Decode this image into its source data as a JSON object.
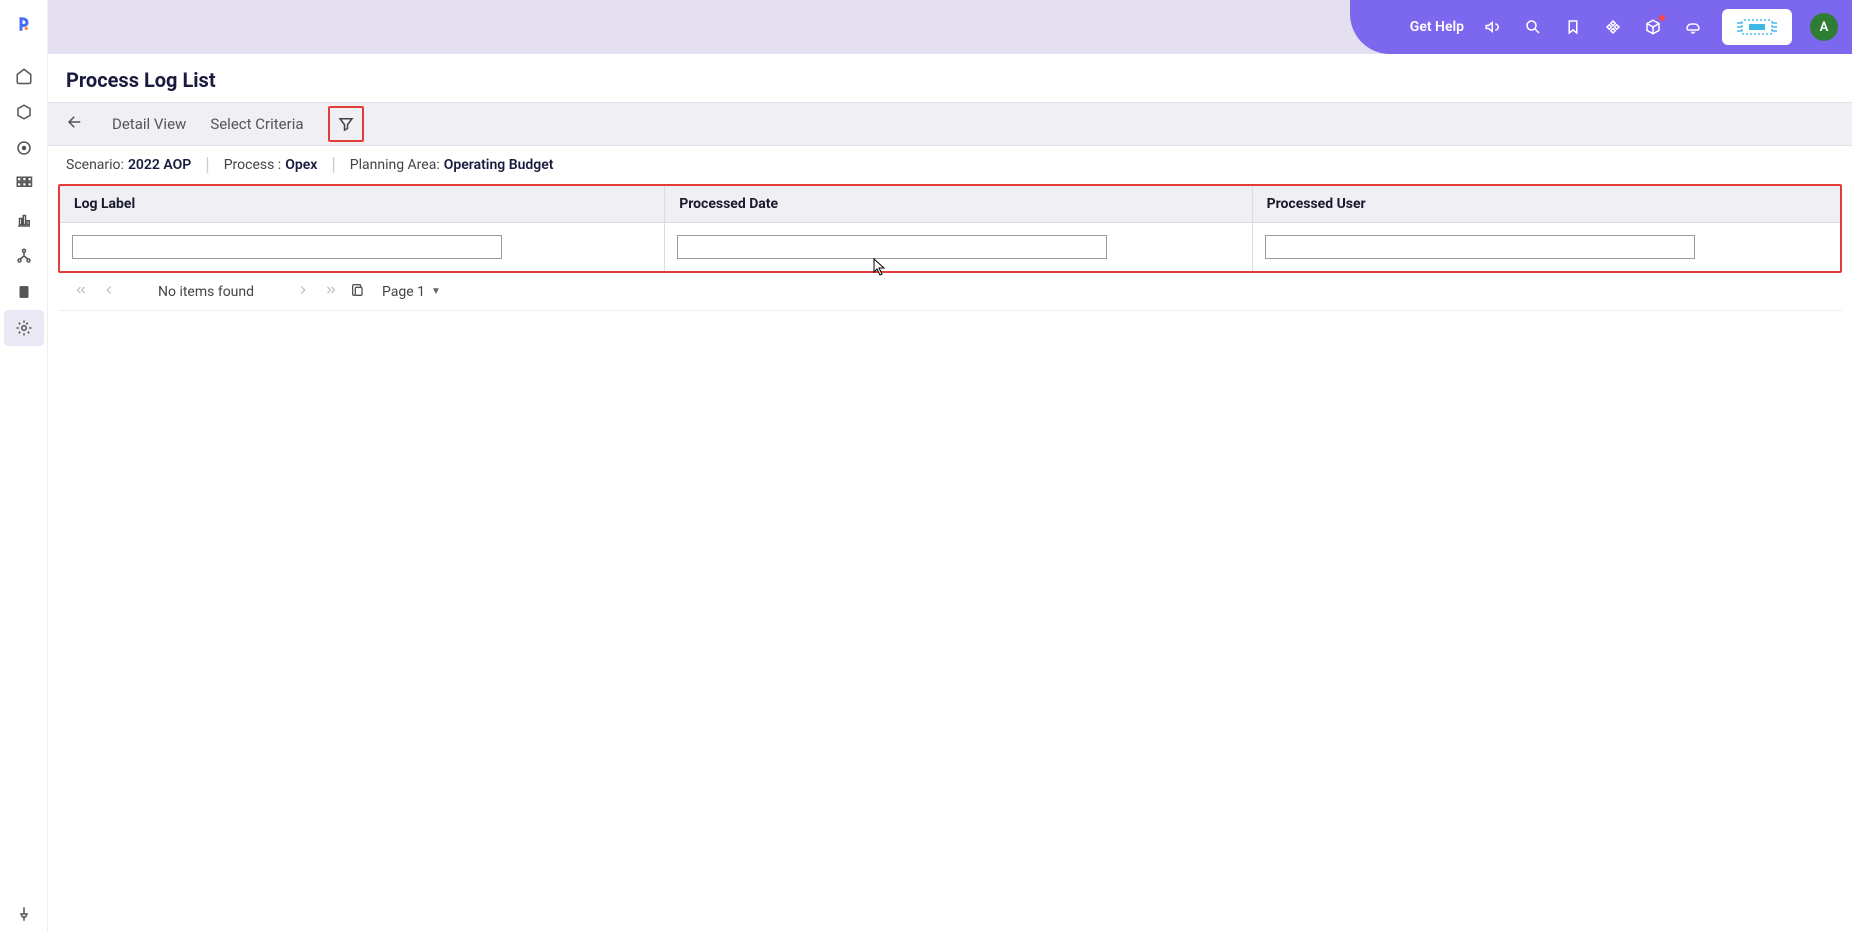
{
  "header": {
    "get_help": "Get Help",
    "avatar_initial": "A"
  },
  "page": {
    "title": "Process Log List"
  },
  "toolbar": {
    "detail_view": "Detail View",
    "select_criteria": "Select Criteria"
  },
  "crumbs": {
    "scenario_label": "Scenario:",
    "scenario_value": "2022 AOP",
    "process_label": "Process :",
    "process_value": "Opex",
    "planning_area_label": "Planning Area:",
    "planning_area_value": "Operating Budget"
  },
  "filters": {
    "col1_label": "Log Label",
    "col2_label": "Processed Date",
    "col3_label": "Processed User",
    "col1_value": "",
    "col2_value": "",
    "col3_value": ""
  },
  "pager": {
    "status": "No items found",
    "page_label": "Page 1"
  }
}
